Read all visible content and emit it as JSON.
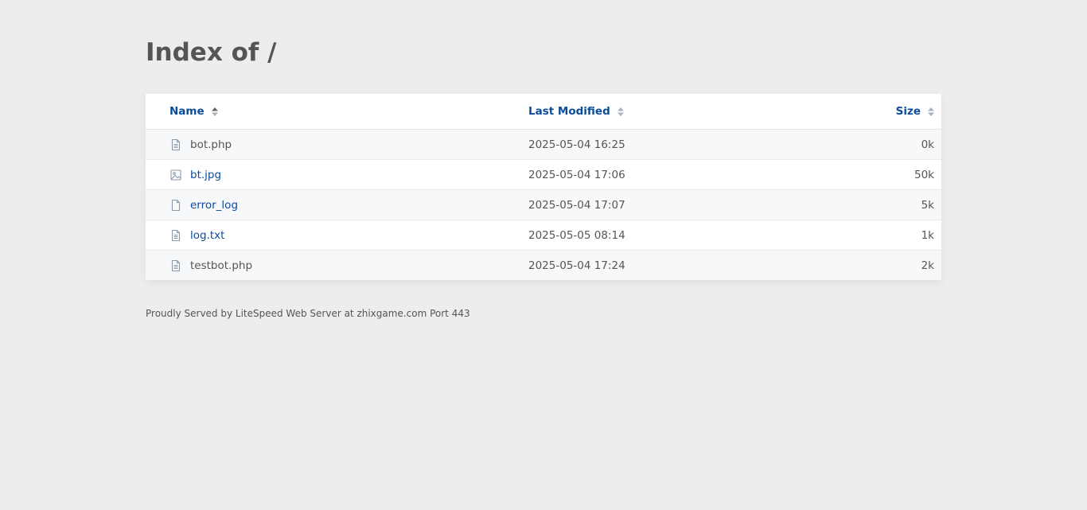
{
  "page": {
    "title": "Index of /"
  },
  "table": {
    "headers": {
      "name": "Name",
      "modified": "Last Modified",
      "size": "Size"
    },
    "rows": [
      {
        "name": "bot.php",
        "modified": "2025-05-04 16:25",
        "size": "0k",
        "icon": "file-text-icon"
      },
      {
        "name": "bt.jpg",
        "modified": "2025-05-04 17:06",
        "size": "50k",
        "icon": "image-icon"
      },
      {
        "name": "error_log",
        "modified": "2025-05-04 17:07",
        "size": "5k",
        "icon": "file-icon"
      },
      {
        "name": "log.txt",
        "modified": "2025-05-05 08:14",
        "size": "1k",
        "icon": "file-text-icon"
      },
      {
        "name": "testbot.php",
        "modified": "2025-05-04 17:24",
        "size": "2k",
        "icon": "file-text-icon"
      }
    ]
  },
  "footer": {
    "text": "Proudly Served by LiteSpeed Web Server at zhixgame.com Port 443"
  },
  "colors": {
    "background": "#ecedee",
    "link": "#0b4c9a",
    "text": "#555555",
    "icon": "#8a9ab0"
  }
}
